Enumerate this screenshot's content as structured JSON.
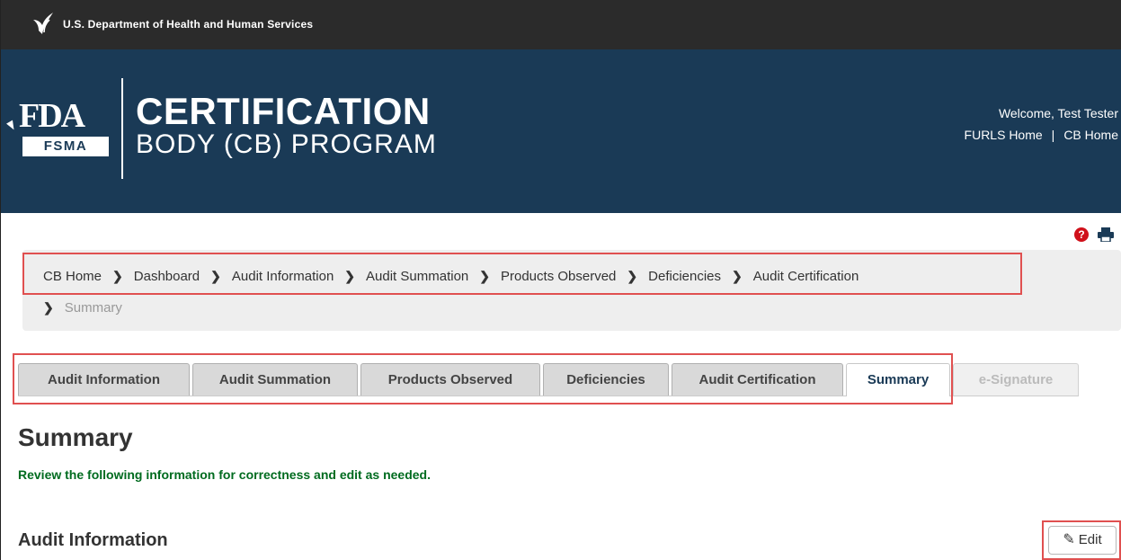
{
  "topbar": {
    "agency": "U.S. Department of Health and Human Services"
  },
  "header": {
    "logo_mark": "FDA",
    "logo_badge": "FSMA",
    "title": "CERTIFICATION",
    "subtitle": "BODY (CB) PROGRAM",
    "welcome": "Welcome, Test Tester",
    "links": [
      {
        "label": "FURLS Home"
      },
      {
        "label": "CB Home"
      }
    ],
    "links_separator": "|"
  },
  "breadcrumb": {
    "items": [
      "CB Home",
      "Dashboard",
      "Audit Information",
      "Audit Summation",
      "Products Observed",
      "Deficiencies",
      "Audit Certification"
    ],
    "current": "Summary"
  },
  "tabs": [
    {
      "label": "Audit Information",
      "state": "default"
    },
    {
      "label": "Audit Summation",
      "state": "default"
    },
    {
      "label": "Products Observed",
      "state": "default"
    },
    {
      "label": "Deficiencies",
      "state": "default"
    },
    {
      "label": "Audit Certification",
      "state": "default"
    },
    {
      "label": "Summary",
      "state": "active"
    },
    {
      "label": "e-Signature",
      "state": "disabled"
    }
  ],
  "main": {
    "heading": "Summary",
    "instructions": "Review the following information for correctness and edit as needed.",
    "section_heading": "Audit Information",
    "edit_label": "Edit"
  },
  "icons": {
    "help": "help-icon",
    "print": "printer-icon",
    "edit": "pencil-icon",
    "agency": "hhs-eagle-icon"
  },
  "colors": {
    "header_bg": "#1a3a56",
    "topbar_bg": "#2b2b2b",
    "help_red": "#d0101a",
    "instruction_green": "#006b1f",
    "highlight_red": "#e05050"
  }
}
